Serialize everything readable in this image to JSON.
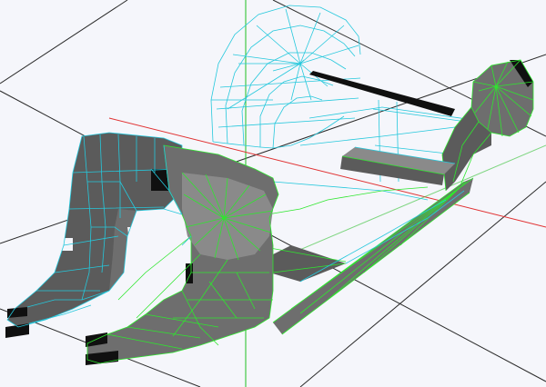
{
  "colors": {
    "background": "#f5f6fb",
    "grid": "#2a2a2a",
    "axis_x": "#e03030",
    "axis_y": "#20c020",
    "axis_z": "#30c030",
    "mesh_cyan": "#25c8dc",
    "mesh_green": "#2ee62e",
    "face_dark": "#5b5b5b",
    "face_mid": "#6e6e6e",
    "face_light": "#8a8a8a",
    "face_black": "#101010"
  },
  "scene": {
    "view": "perspective",
    "render_mode": "shaded-with-edges",
    "grid_visible": true,
    "axes_visible": true
  }
}
